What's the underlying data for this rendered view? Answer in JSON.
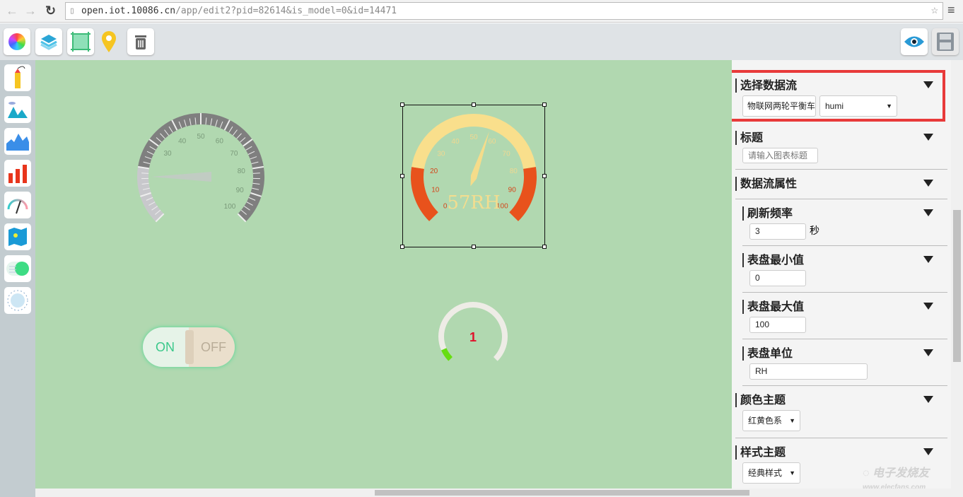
{
  "browser": {
    "url_host": "open.iot.10086.cn",
    "url_path": "/app/edit2?pid=82614&is_model=0&id=14471"
  },
  "toolbar": {
    "icons": [
      "color-wheel-icon",
      "layers-icon",
      "frame-icon",
      "map-pin-icon",
      "trash-icon"
    ],
    "right_icons": [
      "eye-icon",
      "save-icon"
    ]
  },
  "sidebar": {
    "icons": [
      "text-tool-icon",
      "image-icon",
      "area-chart-icon",
      "bar-chart-icon",
      "gauge-icon",
      "map-icon",
      "switch-icon",
      "knob-icon"
    ]
  },
  "canvas": {
    "gauge_left": {
      "ticks": [
        "30",
        "40",
        "50",
        "60",
        "70",
        "80",
        "90",
        "100"
      ]
    },
    "gauge_right": {
      "ticks": [
        "0",
        "10",
        "20",
        "30",
        "40",
        "50",
        "60",
        "70",
        "80",
        "90",
        "100"
      ],
      "value": 57,
      "readout": "57RH",
      "colors": {
        "arc": "#f9df8c",
        "danger": "#e8521c"
      }
    },
    "switch": {
      "on": "ON",
      "off": "OFF"
    },
    "ring": {
      "value": "1",
      "fill_fraction": 0.08,
      "color": "#66dd11"
    }
  },
  "panel": {
    "datastream": {
      "title": "选择数据流",
      "device": "物联网两轮平衡车",
      "stream": "humi"
    },
    "title_sec": {
      "title": "标题",
      "placeholder": "请输入图表标题"
    },
    "props": {
      "title": "数据流属性"
    },
    "refresh": {
      "title": "刷新频率",
      "value": "3",
      "unit": "秒"
    },
    "min": {
      "title": "表盘最小值",
      "value": "0"
    },
    "max": {
      "title": "表盘最大值",
      "value": "100"
    },
    "unit": {
      "title": "表盘单位",
      "value": "RH"
    },
    "color": {
      "title": "颜色主题",
      "value": "红黄色系"
    },
    "style": {
      "title": "样式主题",
      "value": "经典样式"
    }
  },
  "watermark": "电子发烧友 www.elecfans.com",
  "highlight_color": "#e83a3a"
}
